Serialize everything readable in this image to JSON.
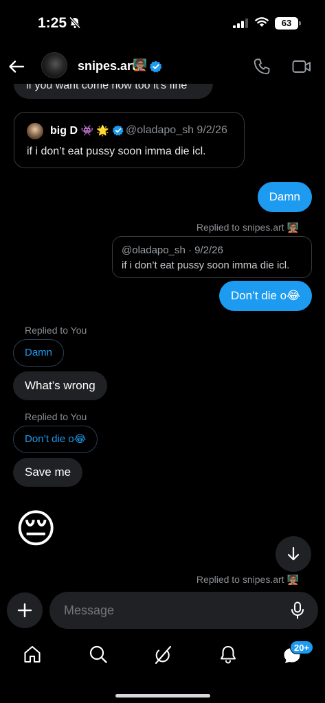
{
  "status_bar": {
    "time": "1:25",
    "battery": "63"
  },
  "header": {
    "username": "snipes.art",
    "username_emoji": "🧑🏽‍🏫"
  },
  "messages": {
    "cut_text": "if you want come now too it's fine",
    "quote_card": {
      "name": "big D",
      "name_emojis": "👾 🌟",
      "handle_date": "@oladapo_sh   9/2/26",
      "text": "if i don’t eat pussy soon imma die icl."
    },
    "damn_out": "Damn",
    "replied_to_snipes": "Replied to snipes.art",
    "replied_emoji": "🧑🏽‍🏫",
    "reply_quote": {
      "meta": "@oladapo_sh · 9/2/26",
      "text": "if i don’t eat pussy soon imma die icl."
    },
    "dont_die_out": "Don’t die o😂",
    "replied_to_you_1": "Replied to You",
    "reply_ref_1": "Damn",
    "whats_wrong": "What’s  wrong",
    "replied_to_you_2": "Replied to You",
    "reply_ref_2": "Don’t die o😂",
    "save_me": "Save me",
    "big_emoji": "😔",
    "replied_to_snipes_bottom": "Replied to snipes.art"
  },
  "composer": {
    "placeholder": "Message"
  },
  "nav": {
    "badge": "20+"
  },
  "colors": {
    "accent": "#1d9bf0",
    "bubble_gray": "#202124",
    "background": "#000000"
  }
}
